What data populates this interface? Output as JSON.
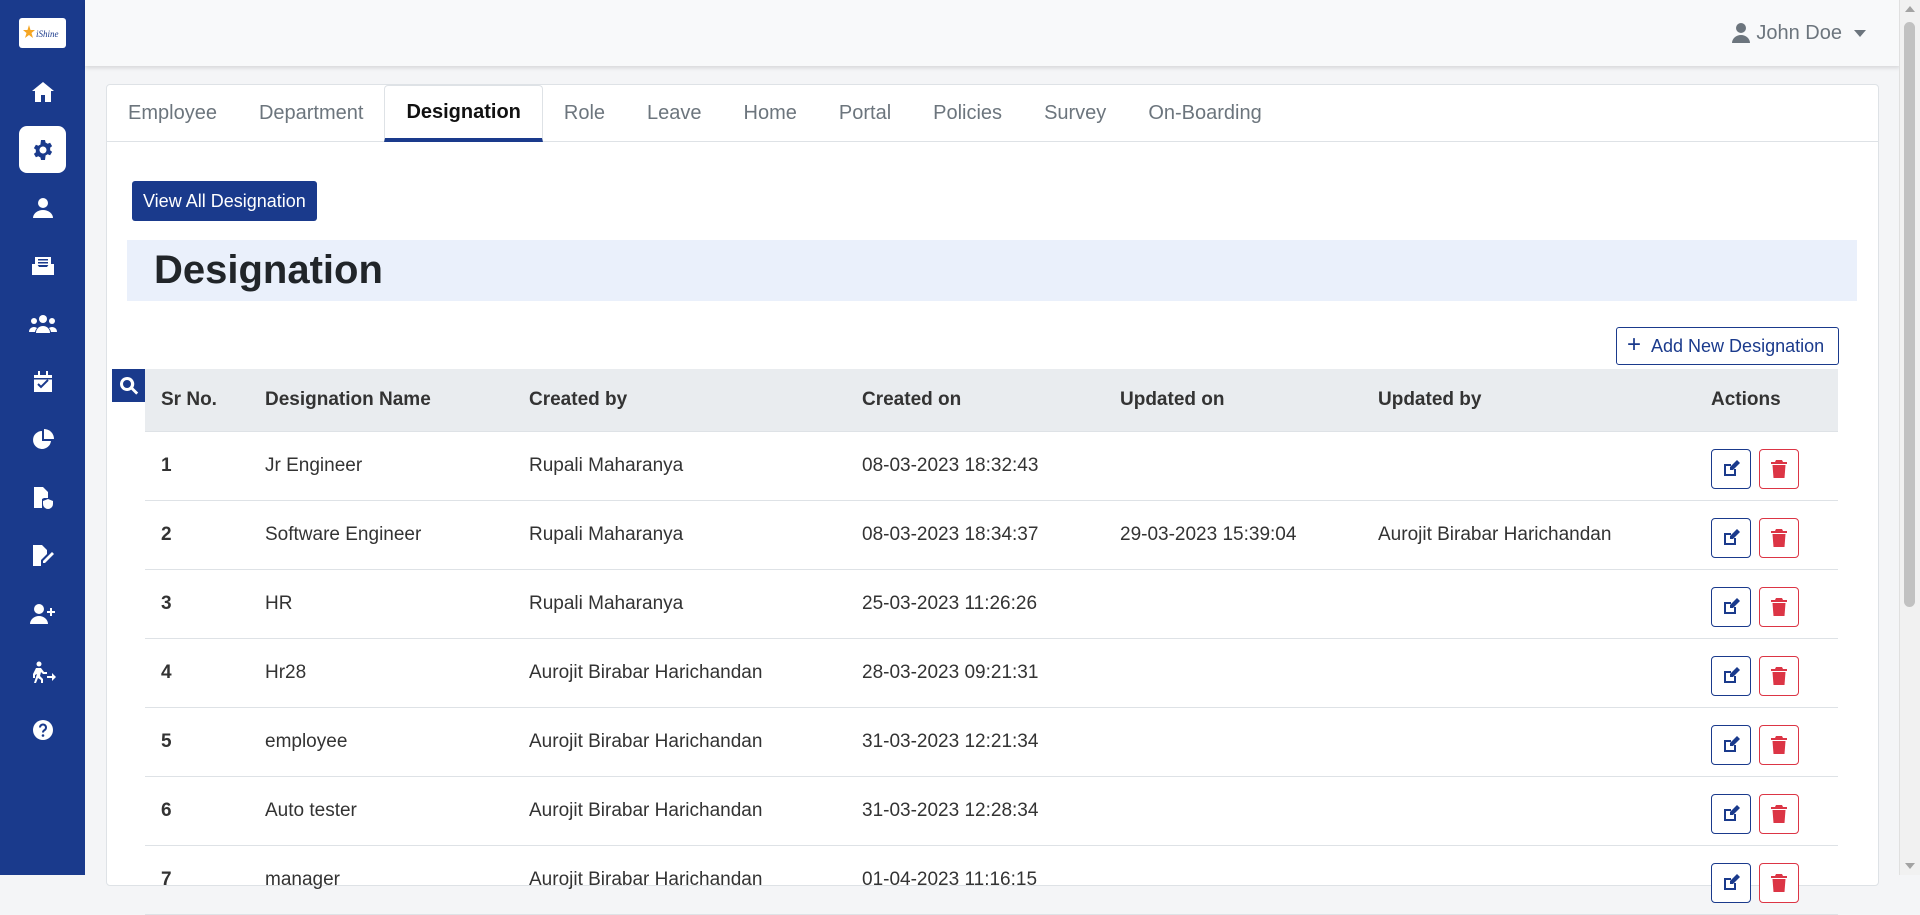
{
  "user": {
    "name": "John Doe",
    "icon": "user-icon"
  },
  "sidebar": {
    "logo_text": "iShine",
    "items": [
      {
        "name": "home",
        "icon": "home-icon"
      },
      {
        "name": "settings",
        "icon": "gear-icon",
        "active": true
      },
      {
        "name": "profile",
        "icon": "user-icon"
      },
      {
        "name": "inbox",
        "icon": "inbox-icon"
      },
      {
        "name": "teams",
        "icon": "users-icon"
      },
      {
        "name": "calendar",
        "icon": "calendar-check-icon"
      },
      {
        "name": "reports",
        "icon": "pie-chart-icon"
      },
      {
        "name": "policies",
        "icon": "file-shield-icon"
      },
      {
        "name": "documents",
        "icon": "file-signature-icon"
      },
      {
        "name": "onboarding",
        "icon": "user-plus-icon"
      },
      {
        "name": "exit",
        "icon": "person-running-icon"
      },
      {
        "name": "help",
        "icon": "question-icon"
      }
    ]
  },
  "tabs": [
    "Employee",
    "Department",
    "Designation",
    "Role",
    "Leave",
    "Home",
    "Portal",
    "Policies",
    "Survey",
    "On-Boarding"
  ],
  "active_tab": "Designation",
  "buttons": {
    "view_all": "View All Designation",
    "add_new": "Add New Designation"
  },
  "page_title": "Designation",
  "table": {
    "headers": [
      "Sr No.",
      "Designation Name",
      "Created by",
      "Created on",
      "Updated on",
      "Updated by",
      "Actions"
    ],
    "rows": [
      {
        "sr": "1",
        "name": "Jr Engineer",
        "created_by": "Rupali Maharanya",
        "created_on": "08-03-2023 18:32:43",
        "updated_on": "",
        "updated_by": ""
      },
      {
        "sr": "2",
        "name": "Software Engineer",
        "created_by": "Rupali Maharanya",
        "created_on": "08-03-2023 18:34:37",
        "updated_on": "29-03-2023 15:39:04",
        "updated_by": "Aurojit Birabar Harichandan"
      },
      {
        "sr": "3",
        "name": "HR",
        "created_by": "Rupali Maharanya",
        "created_on": "25-03-2023 11:26:26",
        "updated_on": "",
        "updated_by": ""
      },
      {
        "sr": "4",
        "name": "Hr28",
        "created_by": "Aurojit Birabar Harichandan",
        "created_on": "28-03-2023 09:21:31",
        "updated_on": "",
        "updated_by": ""
      },
      {
        "sr": "5",
        "name": "employee",
        "created_by": "Aurojit Birabar Harichandan",
        "created_on": "31-03-2023 12:21:34",
        "updated_on": "",
        "updated_by": ""
      },
      {
        "sr": "6",
        "name": "Auto tester",
        "created_by": "Aurojit Birabar Harichandan",
        "created_on": "31-03-2023 12:28:34",
        "updated_on": "",
        "updated_by": ""
      },
      {
        "sr": "7",
        "name": "manager",
        "created_by": "Aurojit Birabar Harichandan",
        "created_on": "01-04-2023 11:16:15",
        "updated_on": "",
        "updated_by": ""
      }
    ]
  },
  "colors": {
    "primary": "#1a3a8c",
    "danger": "#dc3545",
    "title_band": "#eaf0fb"
  }
}
